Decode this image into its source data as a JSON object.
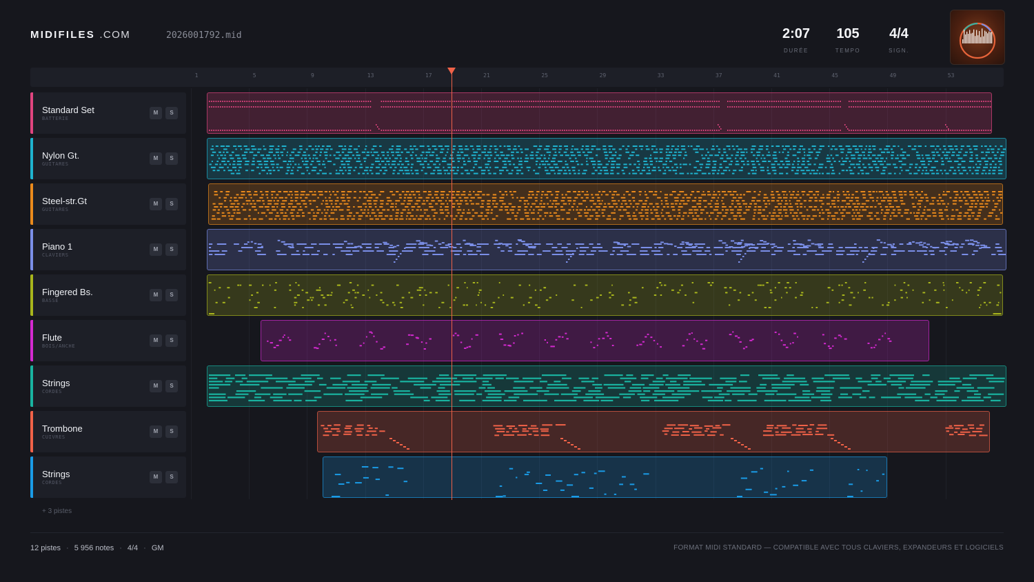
{
  "header": {
    "logo_bold": "MIDIFILES",
    "logo_suffix": ".COM",
    "filename": "2026001792.mid",
    "stats": [
      {
        "value": "2:07",
        "label": "DURÉE"
      },
      {
        "value": "105",
        "label": "TEMPO"
      },
      {
        "value": "4/4",
        "label": "SIGN."
      }
    ],
    "cover_icon": "album-cover-waveform-icon"
  },
  "ruler": {
    "bars": [
      "1",
      "5",
      "9",
      "13",
      "17",
      "21",
      "25",
      "29",
      "33",
      "37",
      "41",
      "45",
      "49",
      "53"
    ]
  },
  "playhead": {
    "bar": 18.5,
    "icon": "playhead-triangle-icon"
  },
  "tracks": [
    {
      "name": "Standard Set",
      "category": "BATTERIE",
      "color": "#e0457f",
      "mute": "M",
      "solo": "S",
      "clip_start_bar": 1.7,
      "clip_end_bar": 55.8,
      "style": "drums"
    },
    {
      "name": "Nylon Gt.",
      "category": "GUITARES",
      "color": "#1fb3cf",
      "mute": "M",
      "solo": "S",
      "clip_start_bar": 1.7,
      "clip_end_bar": 56.8,
      "style": "dense"
    },
    {
      "name": "Steel-str.Gt",
      "category": "GUITARES",
      "color": "#ea8a1c",
      "mute": "M",
      "solo": "S",
      "clip_start_bar": 1.8,
      "clip_end_bar": 56.6,
      "style": "dense"
    },
    {
      "name": "Piano 1",
      "category": "CLAVIERS",
      "color": "#7b8fe8",
      "mute": "M",
      "solo": "S",
      "clip_start_bar": 1.7,
      "clip_end_bar": 56.8,
      "style": "melodic"
    },
    {
      "name": "Fingered Bs.",
      "category": "BASSE",
      "color": "#a8b51c",
      "mute": "M",
      "solo": "S",
      "clip_start_bar": 1.7,
      "clip_end_bar": 56.6,
      "style": "bass"
    },
    {
      "name": "Flute",
      "category": "BOIS/ANCHE",
      "color": "#d42ad0",
      "mute": "M",
      "solo": "S",
      "clip_start_bar": 5.4,
      "clip_end_bar": 51.5,
      "style": "sparse"
    },
    {
      "name": "Strings",
      "category": "CORDES",
      "color": "#19b3a0",
      "mute": "M",
      "solo": "S",
      "clip_start_bar": 1.7,
      "clip_end_bar": 56.8,
      "style": "long"
    },
    {
      "name": "Trombone",
      "category": "CUIVRES",
      "color": "#f06248",
      "mute": "M",
      "solo": "S",
      "clip_start_bar": 9.3,
      "clip_end_bar": 55.7,
      "style": "phrases"
    },
    {
      "name": "Strings",
      "category": "CORDES",
      "color": "#1a9be6",
      "mute": "M",
      "solo": "S",
      "clip_start_bar": 9.7,
      "clip_end_bar": 48.6,
      "style": "sparse2"
    }
  ],
  "more_tracks": "+ 3 pistes",
  "footer": {
    "pistes": "12 pistes",
    "notes": "5 956 notes",
    "signature": "4/4",
    "standard": "GM",
    "notice": "FORMAT MIDI STANDARD — COMPATIBLE AVEC TOUS CLAVIERS, EXPANDEURS ET LOGICIELS"
  }
}
